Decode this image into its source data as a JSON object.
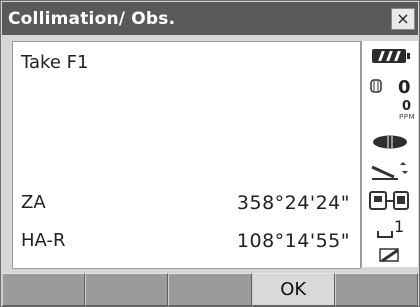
{
  "window": {
    "title": "Collimation/ Obs.",
    "close_label": "×"
  },
  "main": {
    "message": "Take F1",
    "measurements": [
      {
        "label": "ZA",
        "value": "358°24'24\""
      },
      {
        "label": "HA-R",
        "value": "108°14'55\""
      }
    ]
  },
  "status": {
    "prism_constant": "0",
    "ppm_value": "0",
    "ppm_unit": "PPM",
    "shift_indicator": "1"
  },
  "softkeys": [
    "",
    "",
    "",
    "OK",
    ""
  ]
}
